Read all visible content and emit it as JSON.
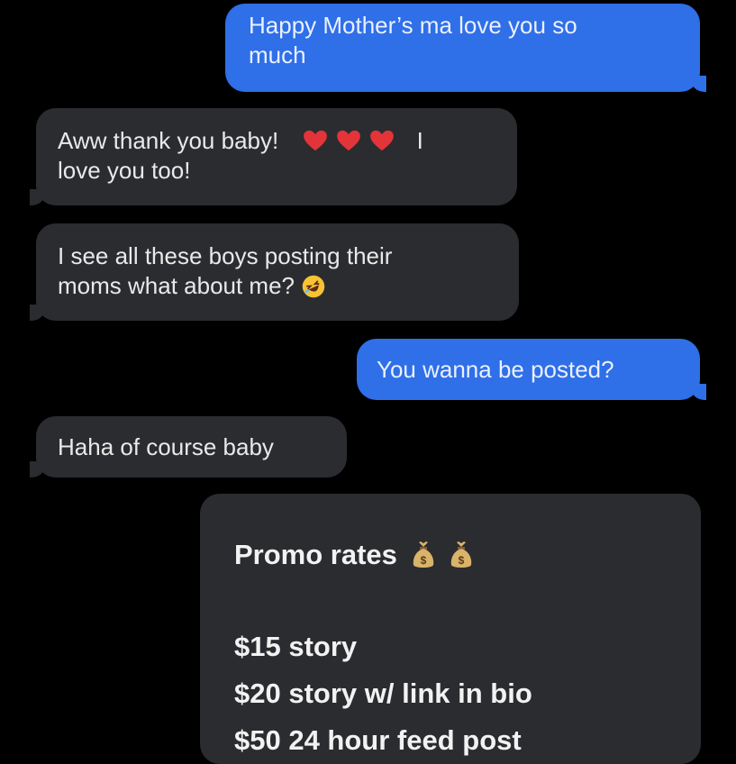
{
  "messages": [
    {
      "text": "Happy Mother’s ma love you so much",
      "line1": "Happy Mother’s ma love you so",
      "line2": "much",
      "sender": "me"
    },
    {
      "line1": "Aww thank you baby!",
      "line1_end": "I",
      "line2": "love you too!",
      "sender": "mom"
    },
    {
      "line1": "I see all these boys posting their",
      "line2": "moms what about me?",
      "sender": "mom"
    },
    {
      "line1": "You wanna be posted?",
      "sender": "me"
    },
    {
      "line1": "Haha of course baby",
      "sender": "mom"
    }
  ],
  "promo": {
    "title": "Promo rates",
    "rates": [
      "$15 story",
      "$20 story w/ link in bio",
      "$50 24 hour feed post"
    ]
  },
  "icons": {
    "heart": "red-heart-icon",
    "laugh": "rolling-on-floor-laughing-icon",
    "money_bag": "money-bag-icon"
  },
  "colors": {
    "outgoing_bubble": "#2f6fe8",
    "incoming_bubble": "#2b2c2f",
    "background": "#000000"
  }
}
